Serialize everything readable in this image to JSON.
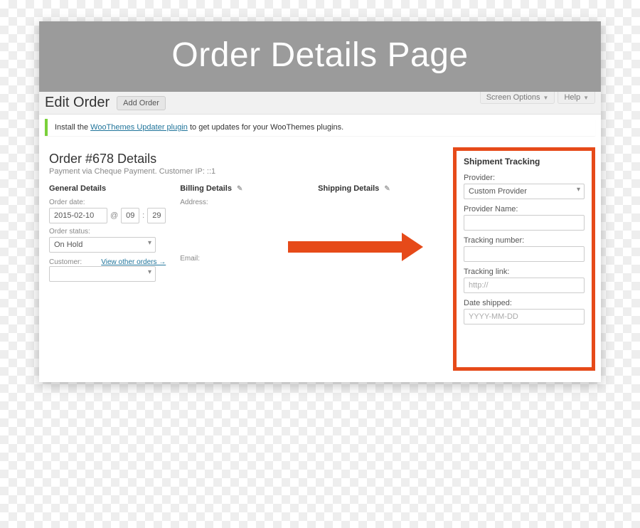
{
  "banner": {
    "title": "Order Details Page"
  },
  "toolbar": {
    "title": "Edit Order",
    "add_order": "Add Order",
    "screen_options": "Screen Options",
    "help": "Help"
  },
  "notice": {
    "prefix": "Install the ",
    "link": "WooThemes Updater plugin",
    "suffix": " to get updates for your WooThemes plugins."
  },
  "order": {
    "title": "Order #678 Details",
    "subtitle": "Payment via Cheque Payment. Customer IP: ::1"
  },
  "general": {
    "heading": "General Details",
    "order_date_label": "Order date:",
    "order_date": "2015-02-10",
    "at": "@",
    "hour": "09",
    "minute": "29",
    "order_status_label": "Order status:",
    "order_status": "On Hold",
    "customer_label": "Customer:",
    "view_other": "View other orders →",
    "customer_value": ""
  },
  "billing": {
    "heading": "Billing Details",
    "address_label": "Address:",
    "email_label": "Email:"
  },
  "shipping": {
    "heading": "Shipping Details"
  },
  "tracking": {
    "heading": "Shipment Tracking",
    "provider_label": "Provider:",
    "provider_value": "Custom Provider",
    "provider_name_label": "Provider Name:",
    "provider_name_value": "",
    "tracking_number_label": "Tracking number:",
    "tracking_number_value": "",
    "tracking_link_label": "Tracking link:",
    "tracking_link_placeholder": "http://",
    "tracking_link_value": "",
    "date_shipped_label": "Date shipped:",
    "date_shipped_placeholder": "YYYY-MM-DD",
    "date_shipped_value": ""
  }
}
